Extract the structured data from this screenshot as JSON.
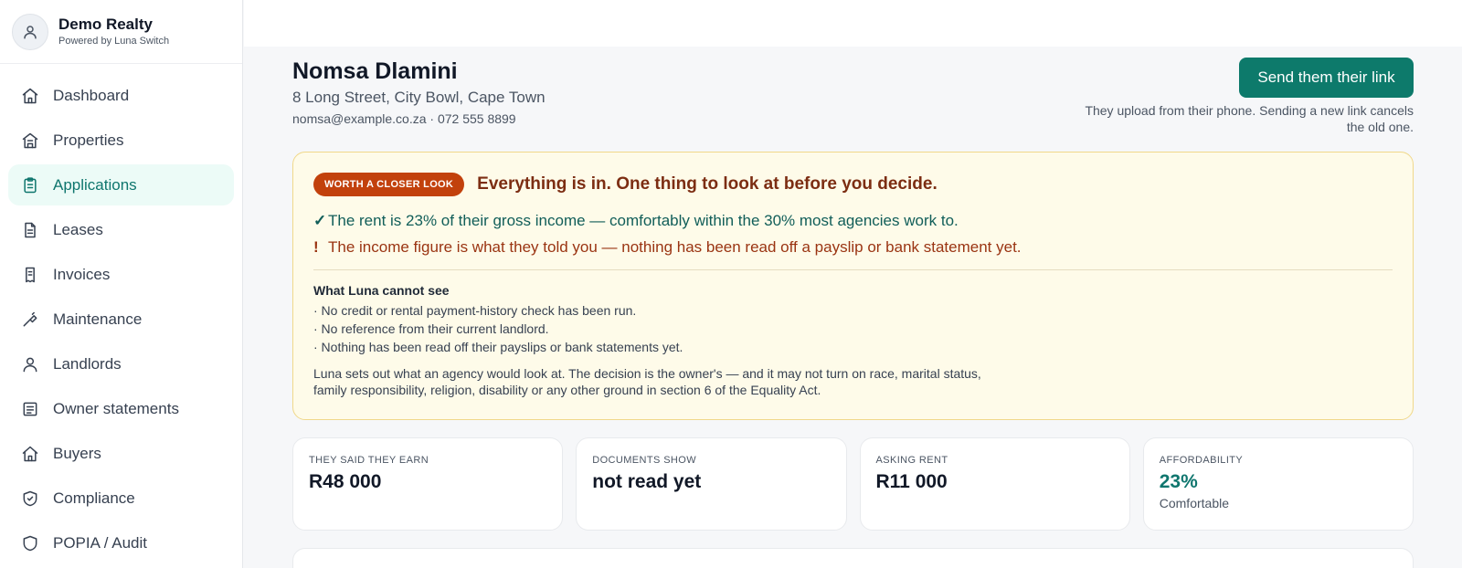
{
  "brand": {
    "title": "Demo Realty",
    "subtitle": "Powered by Luna Switch",
    "avatar_icon": "user-icon"
  },
  "sidebar": {
    "items": [
      {
        "label": "Dashboard",
        "icon": "home-icon",
        "active": false
      },
      {
        "label": "Properties",
        "icon": "building-icon",
        "active": false
      },
      {
        "label": "Applications",
        "icon": "clipboard-icon",
        "active": true
      },
      {
        "label": "Leases",
        "icon": "document-icon",
        "active": false
      },
      {
        "label": "Invoices",
        "icon": "receipt-icon",
        "active": false
      },
      {
        "label": "Maintenance",
        "icon": "wrench-icon",
        "active": false
      },
      {
        "label": "Landlords",
        "icon": "person-icon",
        "active": false
      },
      {
        "label": "Owner statements",
        "icon": "statement-icon",
        "active": false
      },
      {
        "label": "Buyers",
        "icon": "house-icon",
        "active": false
      },
      {
        "label": "Compliance",
        "icon": "shield-check-icon",
        "active": false
      },
      {
        "label": "POPIA / Audit",
        "icon": "shield-icon",
        "active": false
      }
    ]
  },
  "applicant": {
    "name": "Nomsa Dlamini",
    "address": "8 Long Street, City Bowl, Cape Town",
    "contact": "nomsa@example.co.za · 072 555 8899"
  },
  "send": {
    "button_label": "Send them their link",
    "note": "They upload from their phone. Sending a new link cancels the old one."
  },
  "alert": {
    "badge": "WORTH A CLOSER LOOK",
    "title": "Everything is in. One thing to look at before you decide.",
    "ok_mark": "✓",
    "ok_text": "The rent is 23% of their gross income — comfortably within the 30% most agencies work to.",
    "warn_mark": "!",
    "warn_text": "The income figure is what they told you — nothing has been read off a payslip or bank statement yet.",
    "cannot_title": "What Luna cannot see",
    "cannot_items": [
      "· No credit or rental payment-history check has been run.",
      "· No reference from their current landlord.",
      "· Nothing has been read off their payslips or bank statements yet."
    ],
    "disclaimer": "Luna sets out what an agency would look at. The decision is the owner's — and it may not turn on race, marital status, family responsibility, religion, disability or any other ground in section 6 of the Equality Act."
  },
  "stats": [
    {
      "label": "THEY SAID THEY EARN",
      "value": "R48 000",
      "sub": ""
    },
    {
      "label": "DOCUMENTS SHOW",
      "value": "not read yet",
      "sub": ""
    },
    {
      "label": "ASKING RENT",
      "value": "R11 000",
      "sub": ""
    },
    {
      "label": "AFFORDABILITY",
      "value": "23%",
      "sub": "Comfortable"
    }
  ],
  "colors": {
    "accent": "#0d7a6b",
    "badge": "#c2410c",
    "alert_bg": "#fefbe9",
    "alert_border": "#f0d88a"
  }
}
